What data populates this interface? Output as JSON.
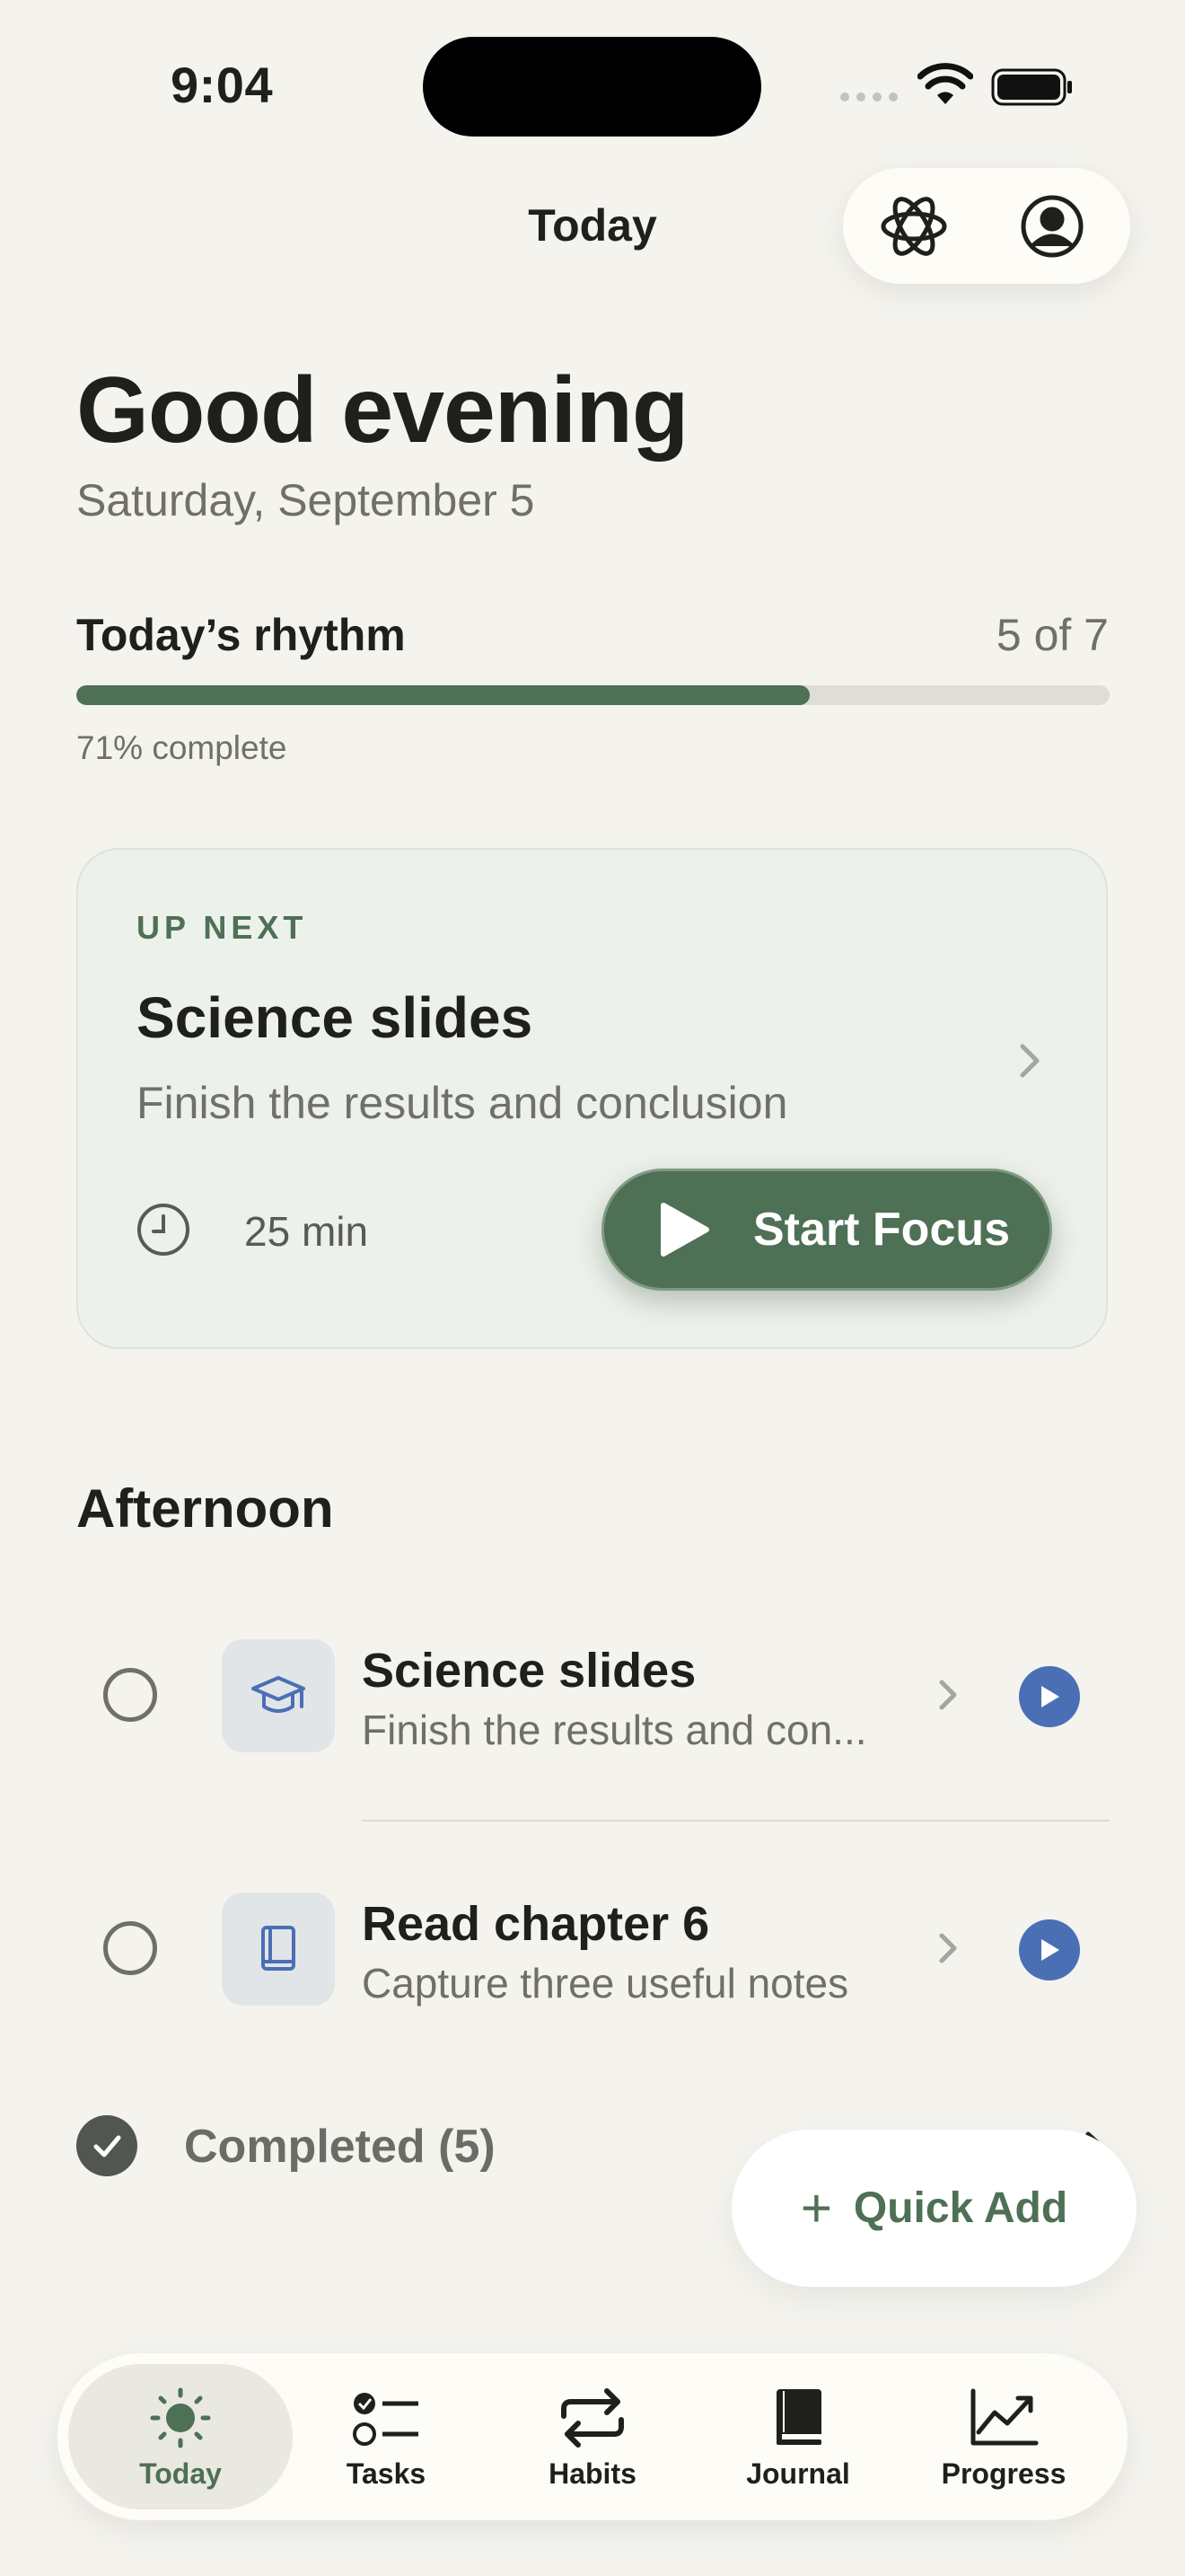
{
  "status_bar": {
    "time": "9:04"
  },
  "nav": {
    "title": "Today",
    "icons": [
      "atom-icon",
      "profile-icon"
    ]
  },
  "header": {
    "greeting": "Good evening",
    "date": "Saturday, September 5"
  },
  "rhythm": {
    "label": "Today’s rhythm",
    "count": "5 of 7",
    "progress_fraction": 0.71,
    "progress_text": "71% complete"
  },
  "up_next": {
    "eyebrow": "UP NEXT",
    "title": "Science slides",
    "subtitle": "Finish the results and conclusion",
    "duration": "25 min",
    "button_label": "Start Focus"
  },
  "afternoon": {
    "title": "Afternoon",
    "tasks": [
      {
        "title": "Science slides",
        "subtitle": "Finish the results and con...",
        "icon": "graduation-cap-icon"
      },
      {
        "title": "Read chapter 6",
        "subtitle": "Capture three useful notes",
        "icon": "book-icon"
      }
    ]
  },
  "completed": {
    "label": "Completed (5)"
  },
  "quick_add": {
    "label": "Quick Add"
  },
  "tabbar": {
    "active": "Today",
    "tabs": [
      {
        "label": "Today",
        "icon": "sun-icon"
      },
      {
        "label": "Tasks",
        "icon": "checklist-icon"
      },
      {
        "label": "Habits",
        "icon": "repeat-icon"
      },
      {
        "label": "Journal",
        "icon": "journal-icon"
      },
      {
        "label": "Progress",
        "icon": "chart-icon"
      }
    ]
  },
  "colors": {
    "accent": "#4E7055",
    "play": "#4A6FB5",
    "background": "#F4F3EE"
  }
}
